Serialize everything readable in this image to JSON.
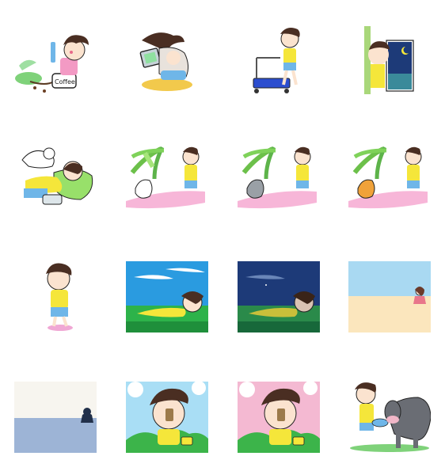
{
  "stickers": [
    {
      "id": 1,
      "icon": "boy-drinking-coffee-icon",
      "mug_text": "Coffee"
    },
    {
      "id": 2,
      "icon": "boy-hugging-laptop-icon"
    },
    {
      "id": 3,
      "icon": "boy-pushing-cart-icon"
    },
    {
      "id": 4,
      "icon": "boy-peeking-window-night-icon"
    },
    {
      "id": 5,
      "icon": "boy-sleeping-with-cat-icon"
    },
    {
      "id": 6,
      "icon": "boy-teasing-white-cat-icon"
    },
    {
      "id": 7,
      "icon": "boy-teasing-gray-cat-icon"
    },
    {
      "id": 8,
      "icon": "boy-teasing-orange-cat-icon"
    },
    {
      "id": 9,
      "icon": "boy-standing-icon"
    },
    {
      "id": 10,
      "icon": "boy-lying-grass-day-icon"
    },
    {
      "id": 11,
      "icon": "boy-lying-grass-night-icon"
    },
    {
      "id": 12,
      "icon": "girl-on-beach-icon"
    },
    {
      "id": 13,
      "icon": "ninja-on-water-icon"
    },
    {
      "id": 14,
      "icon": "boy-thinking-blue-sky-icon"
    },
    {
      "id": 15,
      "icon": "boy-thinking-pink-sky-icon"
    },
    {
      "id": 16,
      "icon": "boy-with-cow-icon"
    }
  ],
  "colors": {
    "shirt": "#f5e63a",
    "shorts": "#6fb6e8",
    "hair": "#4a2e22",
    "skin": "#fbe3cf",
    "grass": "#2db34a",
    "sky_day": "#2a9be0",
    "sky_night": "#1d3a78",
    "pink_ground": "#f7b6d8",
    "beach_sky": "#a9d9f2",
    "beach_sand": "#fbe6bd"
  }
}
